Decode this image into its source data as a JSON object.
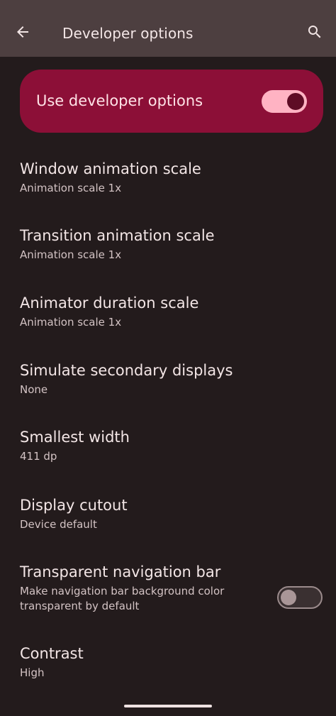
{
  "appbar": {
    "title": "Developer options",
    "back_icon": "arrow-back-icon",
    "search_icon": "search-icon"
  },
  "master": {
    "label": "Use developer options",
    "enabled": true
  },
  "items": [
    {
      "title": "Window animation scale",
      "summary": "Animation scale 1x"
    },
    {
      "title": "Transition animation scale",
      "summary": "Animation scale 1x"
    },
    {
      "title": "Animator duration scale",
      "summary": "Animation scale 1x"
    },
    {
      "title": "Simulate secondary displays",
      "summary": "None"
    },
    {
      "title": "Smallest width",
      "summary": "411 dp"
    },
    {
      "title": "Display cutout",
      "summary": "Device default"
    },
    {
      "title": "Transparent navigation bar",
      "summary": "Make navigation bar background color transparent by default",
      "toggle": false
    },
    {
      "title": "Contrast",
      "summary": "High"
    }
  ],
  "colors": {
    "appbar": "#4d3f40",
    "background": "#231b1c",
    "master_card": "#8c0f37",
    "switch_on_track": "#ffb3c3",
    "switch_on_thumb": "#5e0c25"
  }
}
